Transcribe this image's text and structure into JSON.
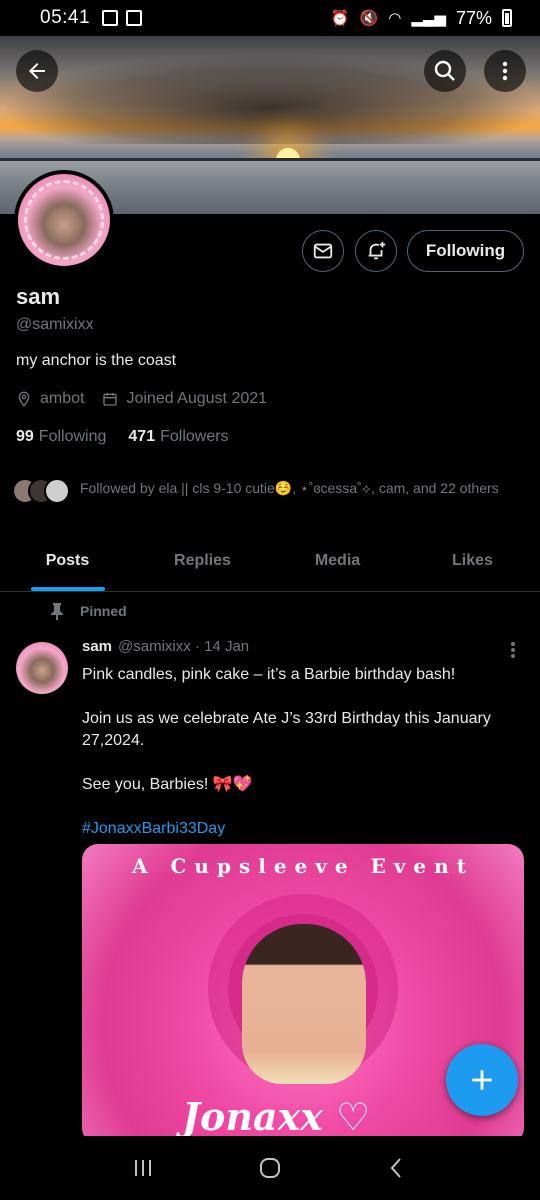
{
  "status_bar": {
    "time": "05:41",
    "battery": "77%"
  },
  "profile": {
    "name": "sam",
    "handle": "@samixixx",
    "bio": "my anchor is the coast",
    "location": "ambot",
    "joined": "Joined August 2021",
    "following_count": "99",
    "following_label": "Following",
    "followers_count": "471",
    "followers_label": "Followers",
    "followed_by": "Followed by ela || cls 9-10 cutie☺️, ⋆˚ɞcessa˚⟡, cam, and 22 others",
    "follow_button": "Following"
  },
  "tabs": [
    {
      "label": "Posts",
      "active": true
    },
    {
      "label": "Replies",
      "active": false
    },
    {
      "label": "Media",
      "active": false
    },
    {
      "label": "Likes",
      "active": false
    }
  ],
  "post": {
    "pinned_label": "Pinned",
    "author": "sam",
    "handle_date": "@samixixx · 14 Jan",
    "line1": "Pink candles, pink cake – it’s a Barbie birthday bash!",
    "line2": "Join us as we celebrate Ate J’s 33rd Birthday this January 27,2024.",
    "line3": "See you, Barbies! 🎀💖",
    "hashtag": "#JonaxxBarbi33Day",
    "image_header": "A Cupsleeve Event",
    "image_script": "Jonaxx ♡"
  },
  "colors": {
    "accent": "#1d9bf0",
    "muted": "#71767b",
    "border": "#536471",
    "background": "#000000"
  },
  "icons": {
    "back": "back-arrow-icon",
    "search": "search-icon",
    "more": "more-vertical-icon",
    "message": "mail-icon",
    "notify": "bell-plus-icon",
    "location": "location-pin-icon",
    "calendar": "calendar-icon",
    "pin": "pin-icon",
    "compose": "plus-icon"
  }
}
